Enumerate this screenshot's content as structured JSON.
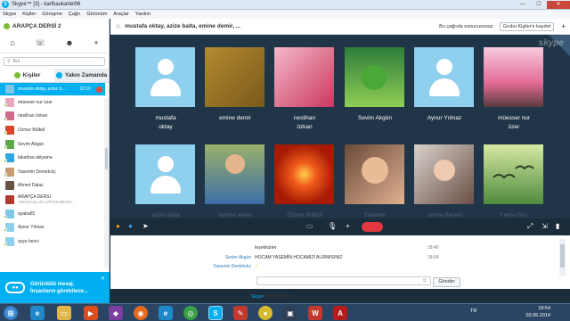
{
  "window": {
    "title": "Skype™ [3] - karfkaukartel06",
    "buttons": [
      "—",
      "☐",
      "✕"
    ]
  },
  "menu": [
    "Skype",
    "Kişiler",
    "Görüşme",
    "Çağrı",
    "Görünüm",
    "Araçlar",
    "Yardım"
  ],
  "sidebar": {
    "group_name": "ARAPÇA DERSİ 2",
    "search_placeholder": "Bul",
    "tabs": [
      {
        "label": "Kişiler",
        "active": true
      },
      {
        "label": "Yakın Zamanda",
        "active": false
      }
    ],
    "contacts": [
      {
        "name": "mustafa oktay, azize b...",
        "time": "10:10",
        "selected": true
      },
      {
        "name": "müesser nur üzer"
      },
      {
        "name": "neslihan özkan"
      },
      {
        "name": "Özmur Bülbül"
      },
      {
        "name": "Sevim Akgün"
      },
      {
        "name": "takahisa akiyama"
      },
      {
        "name": "Yasemin Demirkılıç"
      },
      {
        "name": "Ahmet Dalaz"
      },
      {
        "name": "ARAPÇA DERSİ",
        "sub": "ARKADAŞLAR LÜTFEN MİKRO..."
      },
      {
        "name": "ayaba65"
      },
      {
        "name": "Aynur Yılmaz"
      },
      {
        "name": "ayşe bezci"
      }
    ],
    "promo": {
      "line1": "Görüntülü mesaj.",
      "line2": "İnsanların görebilece..."
    }
  },
  "conversation": {
    "participants": "mustafa oktay, azize balta, emine demir, ...",
    "info": "Bu çağrıda sunucusunuz",
    "add_button": "Grubu Kişiler'e kaydet"
  },
  "watermark": "skype",
  "call": {
    "tiles": [
      {
        "name": "mustafa\noktay",
        "photo": "default"
      },
      {
        "name": "emine demir",
        "photo": "gold"
      },
      {
        "name": "neslihan\nözkan",
        "photo": "pink"
      },
      {
        "name": "Sevim Akgün",
        "photo": "frog"
      },
      {
        "name": "Aynur Yılmaz",
        "photo": "default"
      },
      {
        "name": "müesser nur\nüzer",
        "photo": "blossom"
      },
      {
        "name": "azize balta",
        "photo": "default"
      },
      {
        "name": "fadime aliner",
        "photo": "boy"
      },
      {
        "name": "Özmur Bülbül",
        "photo": "flower"
      },
      {
        "name": "Yasemin\nDemirkılıç",
        "photo": "baby"
      },
      {
        "name": "emine Beceri\nGüner",
        "photo": "girl"
      },
      {
        "name": "Fatma Nur\nVigne",
        "photo": "birds"
      }
    ]
  },
  "chat": {
    "messages": [
      {
        "sender": "",
        "text": "teşekkürler",
        "time": "18:40"
      },
      {
        "sender": "Sevim Akgün",
        "text": "HOCAM YASEMİN HOCAMIZI ALIRMISINIZ",
        "time": "18:54"
      },
      {
        "sender": "Yasemin Demirkılıç",
        "text": "✓",
        "time": ""
      }
    ],
    "send_label": "Gönder",
    "via_prefix": "Skype",
    "via_suffix": "vasıtasıyla ▾"
  },
  "taskbar": {
    "lang": "TR",
    "time": "18:54",
    "date": "03.05.2014"
  },
  "colors": {
    "skype_blue": "#00aff0",
    "stage_bg": "#203547",
    "hangup_red": "#e0383e",
    "online_green": "#7bbf34"
  }
}
